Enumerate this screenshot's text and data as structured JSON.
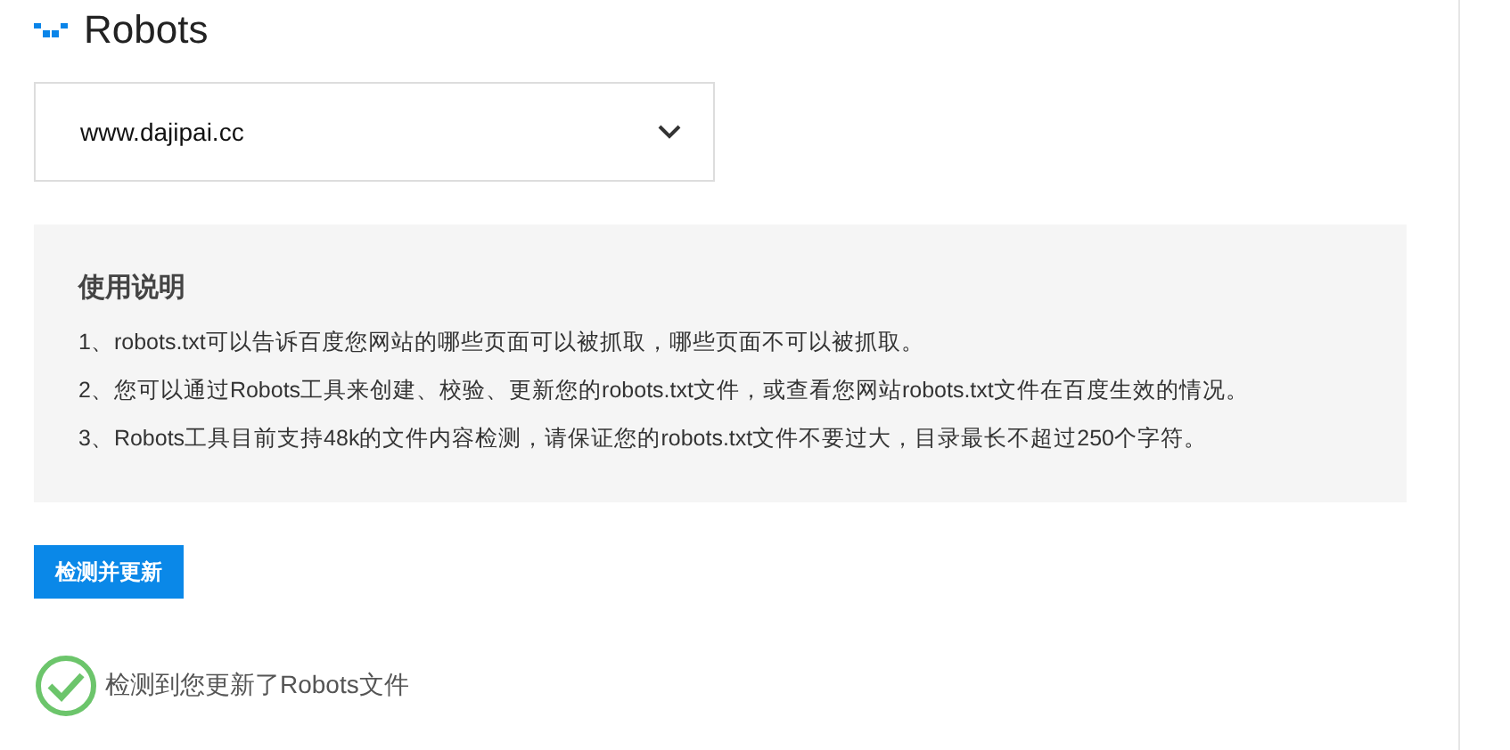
{
  "title": "Robots",
  "site_select": {
    "value": "www.dajipai.cc"
  },
  "instructions": {
    "heading": "使用说明",
    "lines": [
      "1、robots.txt可以告诉百度您网站的哪些页面可以被抓取，哪些页面不可以被抓取。",
      "2、您可以通过Robots工具来创建、校验、更新您的robots.txt文件，或查看您网站robots.txt文件在百度生效的情况。",
      "3、Robots工具目前支持48k的文件内容检测，请保证您的robots.txt文件不要过大，目录最长不超过250个字符。"
    ]
  },
  "check_button": "检测并更新",
  "result": {
    "kind": "success",
    "message": "检测到您更新了Robots文件"
  }
}
